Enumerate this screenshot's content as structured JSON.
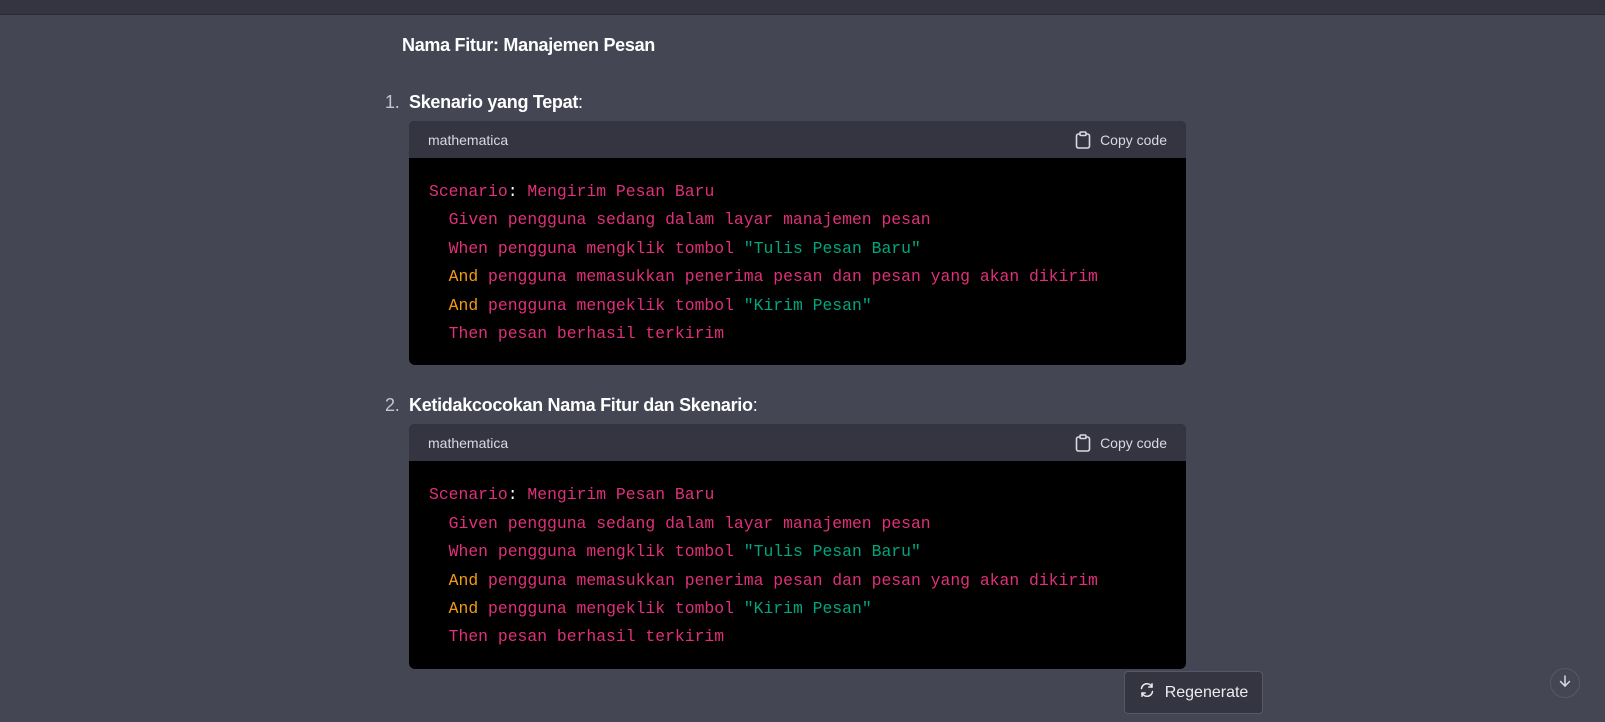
{
  "feature": {
    "title": "Nama Fitur: Manajemen Pesan"
  },
  "sections": [
    {
      "number": "1.",
      "heading": "Skenario yang Tepat",
      "suffix": ":",
      "code": {
        "language": "mathematica",
        "copy_label": "Copy code",
        "lines": [
          [
            {
              "t": "kw",
              "v": "Scenario"
            },
            {
              "t": "plain",
              "v": ": "
            },
            {
              "t": "kw",
              "v": "Mengirim Pesan Baru"
            }
          ],
          [
            {
              "t": "kw",
              "v": "  Given pengguna sedang dalam layar manajemen pesan"
            }
          ],
          [
            {
              "t": "kw",
              "v": "  When pengguna mengklik tombol "
            },
            {
              "t": "str",
              "v": "\"Tulis Pesan Baru\""
            }
          ],
          [
            {
              "t": "and",
              "v": "  And "
            },
            {
              "t": "kw",
              "v": "pengguna memasukkan penerima pesan dan pesan yang akan dikirim"
            }
          ],
          [
            {
              "t": "and",
              "v": "  And "
            },
            {
              "t": "kw",
              "v": "pengguna mengeklik tombol "
            },
            {
              "t": "str",
              "v": "\"Kirim Pesan\""
            }
          ],
          [
            {
              "t": "kw",
              "v": "  Then pesan berhasil terkirim"
            }
          ]
        ]
      }
    },
    {
      "number": "2.",
      "heading": "Ketidakcocokan Nama Fitur dan Skenario",
      "suffix": ":",
      "code": {
        "language": "mathematica",
        "copy_label": "Copy code",
        "lines": [
          [
            {
              "t": "kw",
              "v": "Scenario"
            },
            {
              "t": "plain",
              "v": ": "
            },
            {
              "t": "kw",
              "v": "Mengirim Pesan Baru"
            }
          ],
          [
            {
              "t": "kw",
              "v": "  Given pengguna sedang dalam layar manajemen pesan"
            }
          ],
          [
            {
              "t": "kw",
              "v": "  When pengguna mengklik tombol "
            },
            {
              "t": "str",
              "v": "\"Tulis Pesan Baru\""
            }
          ],
          [
            {
              "t": "and",
              "v": "  And "
            },
            {
              "t": "kw",
              "v": "pengguna memasukkan penerima pesan dan pesan yang akan dikirim"
            }
          ],
          [
            {
              "t": "and",
              "v": "  And "
            },
            {
              "t": "kw",
              "v": "pengguna mengeklik tombol "
            },
            {
              "t": "str",
              "v": "\"Kirim Pesan\""
            }
          ],
          [
            {
              "t": "kw",
              "v": "  Then pesan berhasil terkirim"
            }
          ]
        ]
      }
    }
  ],
  "actions": {
    "regenerate_label": "Regenerate"
  },
  "icons": {
    "copy": "clipboard-icon",
    "regenerate": "refresh-icon",
    "scroll": "arrow-down-icon"
  },
  "colors": {
    "background": "#444654",
    "code_bg": "#000000",
    "code_header_bg": "#343541",
    "keyword": "#df3079",
    "and_keyword": "#f29a13",
    "string": "#00a67d"
  }
}
